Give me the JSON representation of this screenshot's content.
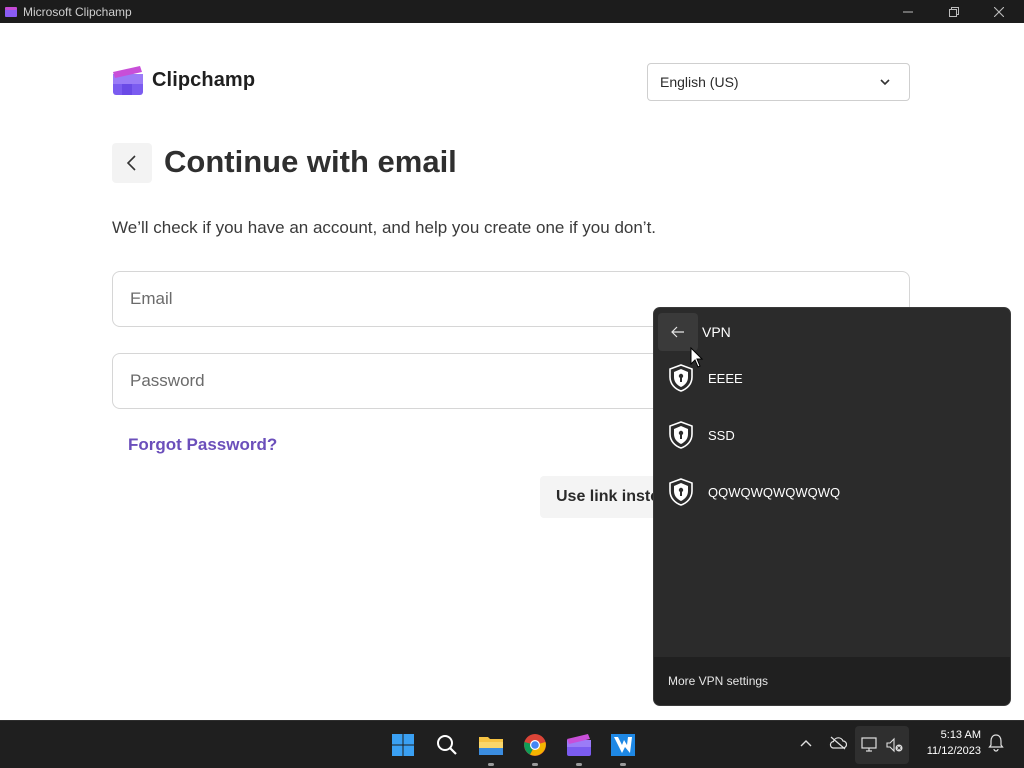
{
  "window": {
    "title": "Microsoft Clipchamp"
  },
  "header": {
    "logo_text": "Clipchamp",
    "language_selected": "English (US)"
  },
  "main": {
    "heading": "Continue with email",
    "subtext": "We’ll check if you have an account, and help you create one if you don’t.",
    "email_placeholder": "Email",
    "password_placeholder": "Password",
    "forgot_label": "Forgot Password?",
    "use_link_label": "Use link instead"
  },
  "vpn_flyout": {
    "title": "VPN",
    "items": [
      {
        "name": "EEEE"
      },
      {
        "name": "SSD"
      },
      {
        "name": "QQWQWQWQWQWQ"
      }
    ],
    "footer_label": "More VPN settings"
  },
  "taskbar": {
    "time": "5:13 AM",
    "date": "11/12/2023"
  },
  "colors": {
    "accent_purple": "#6b4fbb",
    "flyout_bg": "#2b2b2b",
    "taskbar_bg": "#1f1f1f"
  },
  "icons": [
    "start-icon",
    "search-icon",
    "file-explorer-icon",
    "chrome-icon",
    "clipchamp-icon",
    "app-icon",
    "chevron-up-icon",
    "cloud-off-icon",
    "network-icon",
    "volume-muted-icon",
    "bell-icon"
  ]
}
